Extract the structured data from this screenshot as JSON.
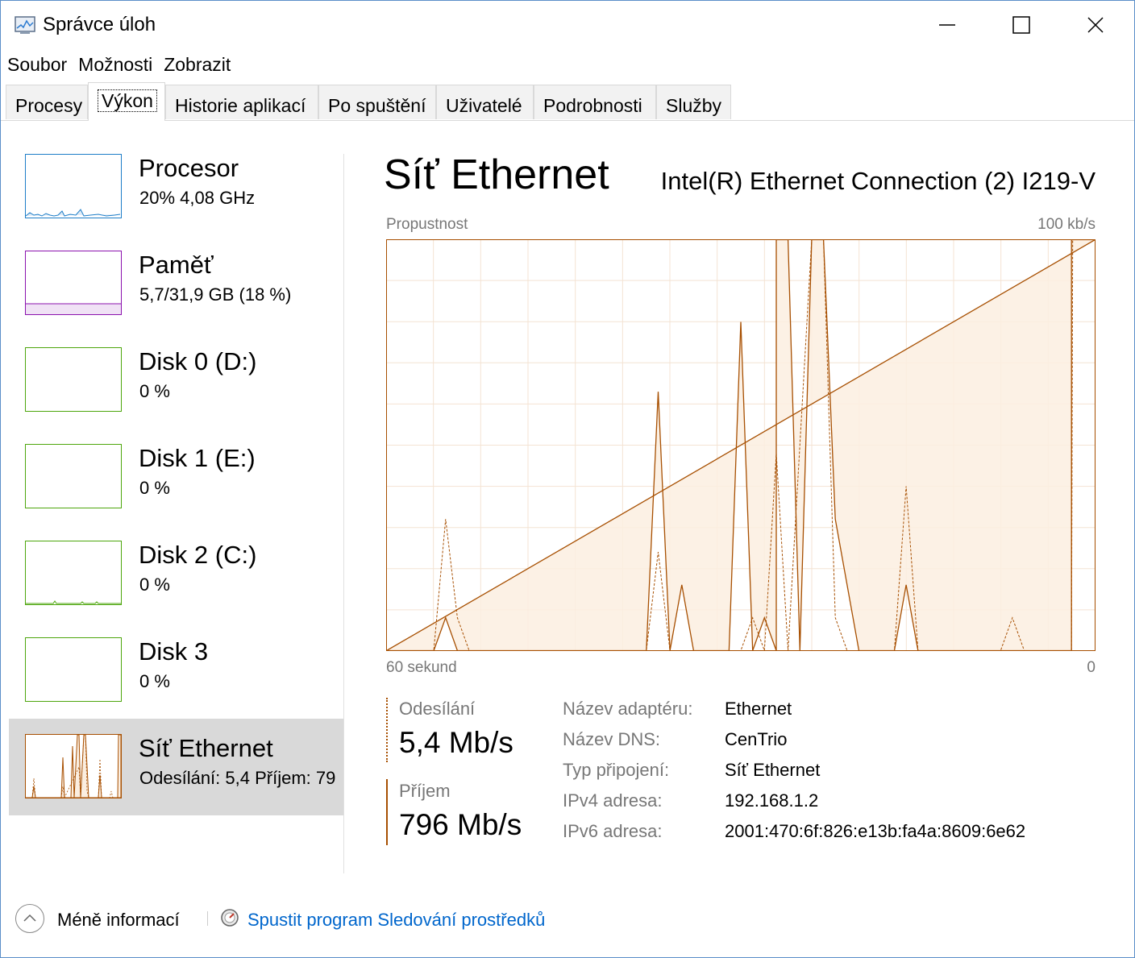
{
  "window": {
    "title": "Správce úloh",
    "accent": "#5b8fc9"
  },
  "menu": [
    {
      "label": "Soubor"
    },
    {
      "label": "Možnosti"
    },
    {
      "label": "Zobrazit"
    }
  ],
  "tabs": [
    {
      "label": "Procesy"
    },
    {
      "label": "Výkon",
      "active": true
    },
    {
      "label": "Historie aplikací"
    },
    {
      "label": "Po spuštění"
    },
    {
      "label": "Uživatelé"
    },
    {
      "label": "Podrobnosti"
    },
    {
      "label": "Služby"
    }
  ],
  "sidebar": {
    "items": [
      {
        "name": "Procesor",
        "value": "20% 4,08 GHz",
        "color": "#1e7ec8"
      },
      {
        "name": "Paměť",
        "value": "5,7/31,9 GB (18 %)",
        "color": "#8b12ae"
      },
      {
        "name": "Disk 0 (D:)",
        "value": "0 %",
        "color": "#4da60c"
      },
      {
        "name": "Disk 1 (E:)",
        "value": "0 %",
        "color": "#4da60c"
      },
      {
        "name": "Disk 2 (C:)",
        "value": "0 %",
        "color": "#4da60c"
      },
      {
        "name": "Disk 3",
        "value": "0 %",
        "color": "#4da60c"
      },
      {
        "name": "Síť Ethernet",
        "value": "Odesílání: 5,4 Příjem: 79",
        "color": "#a74f01",
        "selected": true
      }
    ]
  },
  "main": {
    "title": "Síť Ethernet",
    "adapter": "Intel(R) Ethernet Connection (2) I219-V",
    "graph": {
      "label_top_left": "Propustnost",
      "label_top_right": "100 kb/s",
      "label_bottom_left": "60 sekund",
      "label_bottom_right": "0",
      "color": "#a74f01"
    },
    "send": {
      "label": "Odesílání",
      "value": "5,4 Mb/s"
    },
    "receive": {
      "label": "Příjem",
      "value": "796 Mb/s"
    },
    "info": [
      {
        "key": "Název adaptéru:",
        "value": "Ethernet"
      },
      {
        "key": "Název DNS:",
        "value": "CenTrio"
      },
      {
        "key": "Typ připojení:",
        "value": "Síť Ethernet"
      },
      {
        "key": "IPv4 adresa:",
        "value": "192.168.1.2"
      },
      {
        "key": "IPv6 adresa:",
        "value": "2001:470:6f:826:e13b:fa4a:8609:6e62"
      }
    ]
  },
  "footer": {
    "less_info": "Méně informací",
    "resource_monitor_link": "Spustit program Sledování prostředků"
  },
  "chart_data": {
    "type": "area",
    "x_range_seconds": [
      60,
      0
    ],
    "ylim": [
      0,
      100
    ],
    "y_unit": "kb/s",
    "series": [
      {
        "name": "Příjem",
        "style": "solid",
        "points": [
          [
            60,
            0
          ],
          [
            56,
            0
          ],
          [
            55,
            8
          ],
          [
            54,
            0
          ],
          [
            38,
            0
          ],
          [
            37,
            63
          ],
          [
            36,
            0
          ],
          [
            35,
            16
          ],
          [
            34,
            0
          ],
          [
            31,
            0
          ],
          [
            30,
            80
          ],
          [
            29,
            0
          ],
          [
            28,
            8
          ],
          [
            27,
            0
          ],
          [
            27,
            100
          ],
          [
            26,
            100
          ],
          [
            25,
            0
          ],
          [
            24,
            100
          ],
          [
            23,
            100
          ],
          [
            22,
            32
          ],
          [
            20,
            0
          ],
          [
            17,
            0
          ],
          [
            16,
            16
          ],
          [
            15,
            0
          ],
          [
            2,
            0
          ],
          [
            2,
            100
          ],
          [
            0,
            100
          ]
        ]
      },
      {
        "name": "Odesílání",
        "style": "dashed",
        "points": [
          [
            60,
            0
          ],
          [
            56,
            0
          ],
          [
            55,
            32
          ],
          [
            54,
            8
          ],
          [
            53,
            0
          ],
          [
            38,
            0
          ],
          [
            37,
            24
          ],
          [
            36,
            0
          ],
          [
            30,
            0
          ],
          [
            29,
            8
          ],
          [
            28,
            0
          ],
          [
            27,
            48
          ],
          [
            26,
            0
          ],
          [
            24,
            100
          ],
          [
            23,
            100
          ],
          [
            22,
            8
          ],
          [
            21,
            0
          ],
          [
            17,
            0
          ],
          [
            16,
            40
          ],
          [
            15,
            0
          ],
          [
            8,
            0
          ],
          [
            7,
            8
          ],
          [
            6,
            0
          ],
          [
            2,
            0
          ],
          [
            1.9,
            100
          ],
          [
            0,
            100
          ]
        ]
      }
    ]
  }
}
